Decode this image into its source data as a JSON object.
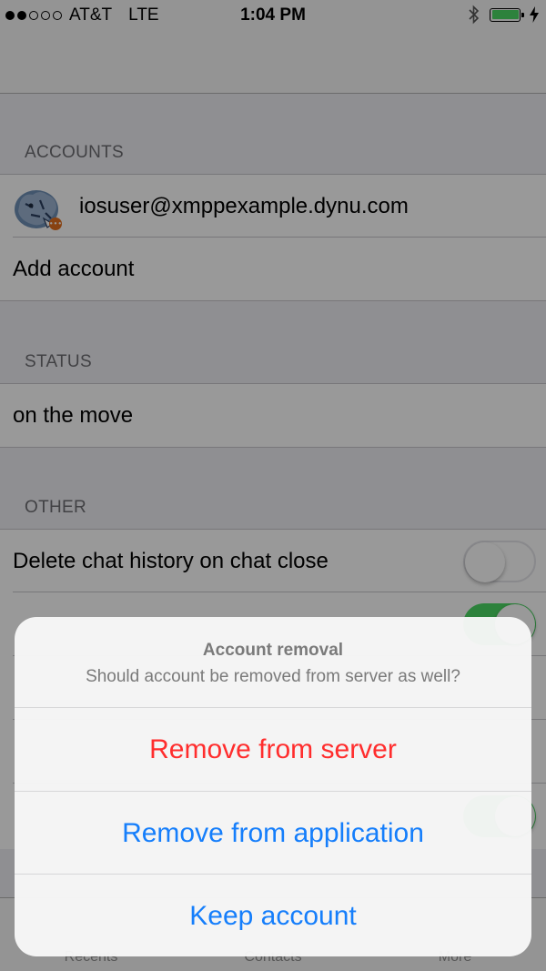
{
  "status_bar": {
    "carrier": "AT&T",
    "network": "LTE",
    "time": "1:04 PM",
    "signal_bars_filled": 2,
    "signal_bars_total": 5,
    "battery_color": "#4cd964"
  },
  "sections": {
    "accounts_header": "ACCOUNTS",
    "status_header": "STATUS",
    "other_header": "OTHER"
  },
  "accounts": {
    "items": [
      {
        "jid": "iosuser@xmppexample.dynu.com",
        "presence_badge": "•••"
      }
    ],
    "add_account_label": "Add account"
  },
  "status": {
    "message": "on the move"
  },
  "other": {
    "delete_history_label": "Delete chat history on chat close",
    "delete_history_enabled": false
  },
  "tabs": [
    {
      "label": "Recents"
    },
    {
      "label": "Contacts"
    },
    {
      "label": "More"
    }
  ],
  "alert": {
    "title": "Account removal",
    "message": "Should account be removed from server as well?",
    "buttons": [
      {
        "label": "Remove from server",
        "style": "destructive"
      },
      {
        "label": "Remove from application",
        "style": "default"
      },
      {
        "label": "Keep account",
        "style": "default"
      }
    ]
  },
  "colors": {
    "accent": "#157efb",
    "destructive": "#ff2d2d",
    "toggle_on": "#4cd964"
  }
}
